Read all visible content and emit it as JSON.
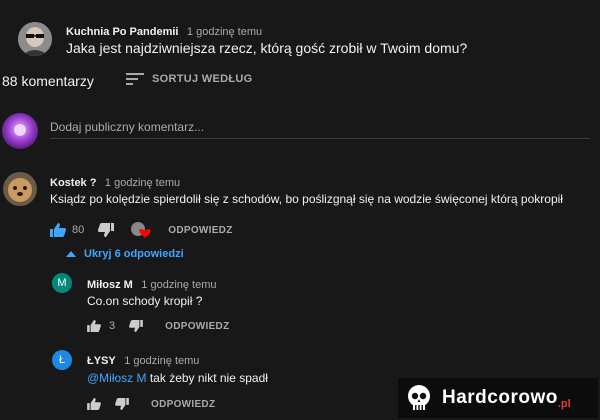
{
  "post": {
    "author": "Kuchnia Po Pandemii",
    "time": "1 godzinę temu",
    "text": "Jaka jest najdziwniejsza rzecz, którą gość zrobił w Twoim domu?"
  },
  "comments_header": {
    "count_label": "88 komentarzy",
    "sort_label": "SORTUJ WEDŁUG"
  },
  "add_comment": {
    "placeholder": "Dodaj publiczny komentarz..."
  },
  "comments": [
    {
      "author": "Kostek ?",
      "time": "1 godzinę temu",
      "text": "Ksiądz po kolędzie spierdolił się z schodów, bo poślizgnął się na wodzie święconej którą pokropił",
      "likes": "80",
      "reply_label": "ODPOWIEDZ",
      "toggle_replies_label": "Ukryj 6 odpowiedzi"
    }
  ],
  "replies": [
    {
      "avatar_letter": "M",
      "author": "Miłosz M",
      "time": "1 godzinę temu",
      "text": "Co.on schody kropił ?",
      "likes": "3",
      "reply_label": "ODPOWIEDZ"
    },
    {
      "avatar_letter": "Ł",
      "author": "ŁYSY",
      "time": "1 godzinę temu",
      "mention": "@Miłosz M",
      "text": " tak żeby nikt nie spadł",
      "reply_label": "ODPOWIEDZ"
    }
  ],
  "watermark": {
    "text": "Hardcorowo",
    "suffix": ".pl"
  },
  "colors": {
    "background": "#181818",
    "link_blue": "#3ea6ff",
    "reply_avatar_1": "#00897b",
    "reply_avatar_2": "#1e88e5"
  }
}
